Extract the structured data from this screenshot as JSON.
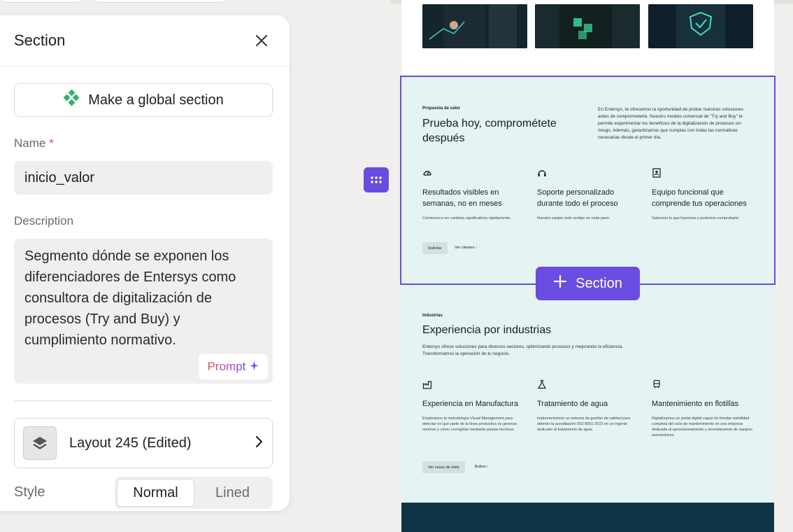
{
  "panel": {
    "title": "Section",
    "global_button": "Make a global section",
    "name_label": "Name",
    "required_mark": "*",
    "name_value": "inicio_valor",
    "description_label": "Description",
    "description_value": "Segmento dónde se exponen los diferenciadores de Entersys como consultora de digitalización de procesos (Try and Buy) y cumplimiento normativo.",
    "prompt_label": "Prompt",
    "layout_label": "Layout 245 (Edited)",
    "style_label": "Style",
    "style_options": [
      "Normal",
      "Lined"
    ],
    "style_selected": "Normal"
  },
  "canvas": {
    "add_section_label": "Section",
    "accent_color": "#6a4ce0",
    "value_section": {
      "eyebrow": "Propuesta de valor",
      "title": "Prueba hoy, comprométete después",
      "intro": "En Entersys, te ofrecemos la oportunidad de probar nuestras soluciones antes de comprometerte. Nuestro modelo comercial de \"Try and Buy\" te permite experimentar los beneficios de la digitalización de procesos sin riesgo. Además, garantizamos que cumplas con todas las normativas necesarias desde el primer día.",
      "features": [
        {
          "icon": "gauge-icon",
          "title": "Resultados visibles en semanas, no en meses",
          "text": "Comienza a ver cambios significativos rápidamente."
        },
        {
          "icon": "headset-icon",
          "title": "Soporte personalizado durante todo el proceso",
          "text": "Nuestro equipo está contigo en cada paso."
        },
        {
          "icon": "contact-book-icon",
          "title": "Equipo funcional que comprende tus operaciones",
          "text": "Sabemos lo que hacemos y podemos comprobarlo."
        }
      ],
      "primary_button": "Solicitar",
      "secondary_link": "Ver clientes"
    },
    "industries_section": {
      "eyebrow": "Industrias",
      "title": "Experiencia por industrias",
      "intro": "Entersys ofrece soluciones para diversos sectores, optimizando procesos y mejorando la eficiencia. Transformamos la operación de tu negocio.",
      "features": [
        {
          "icon": "factory-icon",
          "title": "Experiencia en Manufactura",
          "text": "Empleamos la metodología Visual Management para detectar en qué parte de la línea productiva se generan mermas y cómo corregirlas mediante pautas técnicas."
        },
        {
          "icon": "flask-icon",
          "title": "Tratamiento de agua",
          "text": "Implementamos un sistema de gestión de calidad para obtener la acreditación ISO 9001-2015 en un ingenio dedicado al tratamiento de agua."
        },
        {
          "icon": "bus-icon",
          "title": "Mantenimiento en flotillas",
          "text": "Digitalizamos un portal digital capaz de brindar visibilidad completa del ciclo de mantenimiento en una empresa dedicada al aprovisionamiento y arrendamiento de equipos automotrices."
        }
      ],
      "primary_button": "Ver casos de éxito",
      "secondary_link": "Button"
    }
  }
}
